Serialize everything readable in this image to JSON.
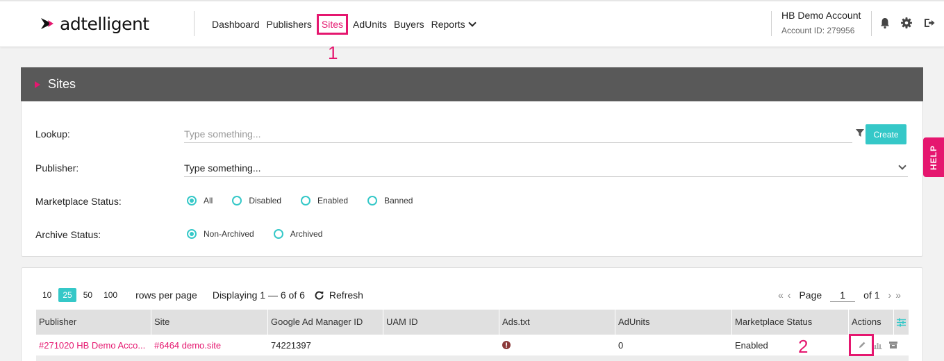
{
  "brand": {
    "name": "adtelligent",
    "accent": "#e5176f",
    "teal": "#35c8c8"
  },
  "nav": {
    "items": [
      {
        "label": "Dashboard"
      },
      {
        "label": "Publishers"
      },
      {
        "label": "Sites",
        "active": true
      },
      {
        "label": "AdUnits"
      },
      {
        "label": "Buyers"
      },
      {
        "label": "Reports"
      }
    ]
  },
  "account": {
    "name": "HB Demo Account",
    "id_text": "Account ID: 279956"
  },
  "annotations": {
    "one": "1",
    "two": "2"
  },
  "panel": {
    "title": "Sites",
    "lookup_label": "Lookup:",
    "lookup_placeholder": "Type something...",
    "create_label": "Create",
    "publisher_label": "Publisher:",
    "publisher_value": "Type something...",
    "marketplace_label": "Marketplace Status:",
    "marketplace_options": [
      "All",
      "Disabled",
      "Enabled",
      "Banned"
    ],
    "marketplace_selected": "All",
    "archive_label": "Archive Status:",
    "archive_options": [
      "Non-Archived",
      "Archived"
    ],
    "archive_selected": "Non-Archived"
  },
  "help": "HELP",
  "pager": {
    "sizes": [
      "10",
      "25",
      "50",
      "100"
    ],
    "selected_size": "25",
    "rows_per_page": "rows per page",
    "displaying": "Displaying 1 — 6 of 6",
    "refresh": "Refresh",
    "page_label": "Page",
    "page_value": "1",
    "of_label": "of 1"
  },
  "table": {
    "columns": [
      "Publisher",
      "Site",
      "Google Ad Manager ID",
      "UAM ID",
      "Ads.txt",
      "AdUnits",
      "Marketplace Status",
      "Actions"
    ],
    "rows": [
      {
        "publisher": "#271020 HB Demo Acco...",
        "site": "#6464 demo.site",
        "gam_id": "74221397",
        "uam_id": "",
        "adunits": "0",
        "status": "Enabled"
      }
    ]
  }
}
